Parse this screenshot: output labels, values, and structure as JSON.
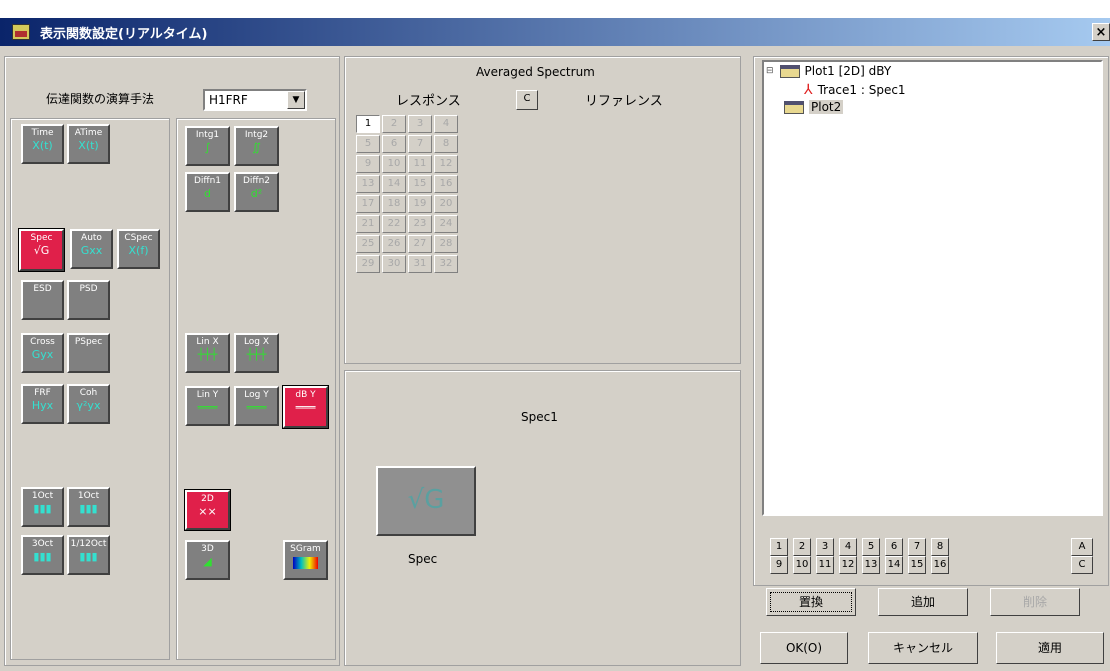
{
  "window": {
    "title": "表示関数設定(リアルタイム)",
    "close": "×"
  },
  "transfer": {
    "label": "伝達関数の演算手法",
    "value": "H1FRF",
    "arrow": "▼"
  },
  "func_buttons": {
    "time": {
      "top": "Time",
      "sub": "X(t)"
    },
    "atime": {
      "top": "ATime",
      "sub": "X(t)"
    },
    "spec": {
      "top": "Spec",
      "sub": "√G"
    },
    "auto": {
      "top": "Auto",
      "sub": "Gxx"
    },
    "cspec": {
      "top": "CSpec",
      "sub": "X(f)"
    },
    "esd": {
      "top": "ESD",
      "sub": ""
    },
    "psd": {
      "top": "PSD",
      "sub": ""
    },
    "cross": {
      "top": "Cross",
      "sub": "Gyx"
    },
    "pspec": {
      "top": "PSpec",
      "sub": ""
    },
    "frf": {
      "top": "FRF",
      "sub": "Hyx"
    },
    "coh": {
      "top": "Coh",
      "sub": "γ²yx"
    },
    "oct1": {
      "top": "1Oct",
      "sub": "▮▮▮"
    },
    "oct1b": {
      "top": "1Oct",
      "sub": "▮▮▮"
    },
    "oct3": {
      "top": "3Oct",
      "sub": "▮▮▮"
    },
    "oct12": {
      "top": "1/12Oct",
      "sub": "▮▮▮"
    },
    "intg1": {
      "top": "Intg1",
      "sub": "∫"
    },
    "intg2": {
      "top": "Intg2",
      "sub": "∬"
    },
    "diffn1": {
      "top": "Diffn1",
      "sub": "d"
    },
    "diffn2": {
      "top": "Diffn2",
      "sub": "d²"
    },
    "linx": {
      "top": "Lin X",
      "sub": "┼┼┼"
    },
    "logx": {
      "top": "Log X",
      "sub": "┼┼┼"
    },
    "liny": {
      "top": "Lin Y",
      "sub": "═══"
    },
    "logy": {
      "top": "Log Y",
      "sub": "═══"
    },
    "dby": {
      "top": "dB Y",
      "sub": "═══"
    },
    "d2": {
      "top": "2D",
      "sub": "⨯⨯"
    },
    "d3": {
      "top": "3D",
      "sub": "◢"
    },
    "sgram": {
      "top": "SGram",
      "sub": ""
    }
  },
  "averaged": {
    "title": "Averaged Spectrum",
    "response": "レスポンス",
    "c_button": "C",
    "reference": "リファレンス",
    "channels": [
      "1",
      "2",
      "3",
      "4",
      "5",
      "6",
      "7",
      "8",
      "9",
      "10",
      "11",
      "12",
      "13",
      "14",
      "15",
      "16",
      "17",
      "18",
      "19",
      "20",
      "21",
      "22",
      "23",
      "24",
      "25",
      "26",
      "27",
      "28",
      "29",
      "30",
      "31",
      "32"
    ]
  },
  "preview": {
    "trace_name": "Spec1",
    "icon_label": "Spec",
    "icon_glyph": "√G"
  },
  "tree": {
    "plot1": "Plot1 [2D] dBY",
    "trace1": "Trace1 : Spec1",
    "plot2": "Plot2",
    "expander": "⊟",
    "trace_icon": "⅄"
  },
  "plot_numbers": [
    "1",
    "2",
    "3",
    "4",
    "5",
    "6",
    "7",
    "8",
    "9",
    "10",
    "11",
    "12",
    "13",
    "14",
    "15",
    "16"
  ],
  "plot_ac": [
    "A",
    "C"
  ],
  "actions": {
    "replace": "置換",
    "add": "追加",
    "delete": "削除"
  },
  "footer": {
    "ok": "OK(O)",
    "cancel": "キャンセル",
    "apply": "適用"
  }
}
